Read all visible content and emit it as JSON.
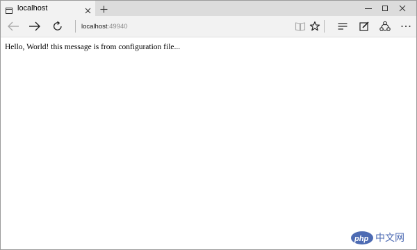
{
  "tab": {
    "title": "localhost",
    "close_icon": "close-icon",
    "page_icon": "page-icon"
  },
  "window_controls": {
    "minimize_icon": "minimize-icon",
    "maximize_icon": "maximize-icon",
    "close_icon": "close-icon"
  },
  "toolbar": {
    "back_icon": "back-arrow-icon",
    "forward_icon": "forward-arrow-icon",
    "refresh_icon": "refresh-icon",
    "reading_view_icon": "book-icon",
    "favorite_icon": "star-icon",
    "hub_icon": "hub-icon",
    "note_icon": "pen-note-icon",
    "share_icon": "share-icon",
    "more_icon": "more-icon"
  },
  "address": {
    "host": "localhost",
    "port": ":49940"
  },
  "page": {
    "message": "Hello, World! this message is from configuration file..."
  },
  "watermark": {
    "logo": "php",
    "text": "中文网"
  },
  "colors": {
    "titlebar": "#dcdcdc",
    "toolbar": "#f2f2f2",
    "watermark": "#4d6bb3"
  }
}
